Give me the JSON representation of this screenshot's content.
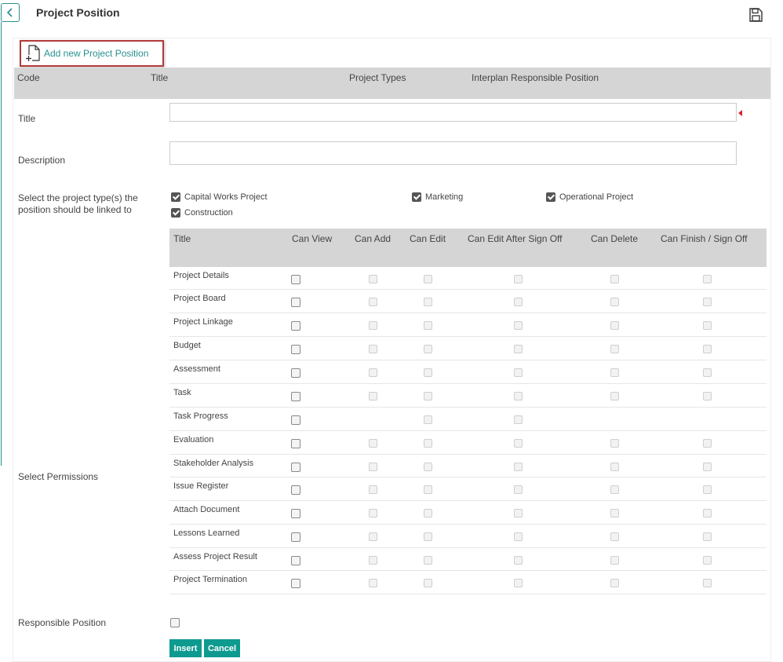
{
  "header": {
    "title": "Project Position",
    "back_icon": "chevron-left-icon",
    "save_icon": "floppy-disk-icon"
  },
  "toolbar": {
    "add_new_label": "Add new Project Position",
    "add_icon": "add-document-icon"
  },
  "grid": {
    "columns": [
      "Code",
      "Title",
      "Project Types",
      "Interplan Responsible Position"
    ]
  },
  "form": {
    "title_label": "Title",
    "title_value": "",
    "description_label": "Description",
    "description_value": "",
    "project_types_label": "Select the project type(s) the position should be linked to",
    "project_types": [
      {
        "label": "Capital Works Project",
        "checked": true
      },
      {
        "label": "Marketing",
        "checked": true
      },
      {
        "label": "Operational Project",
        "checked": true
      },
      {
        "label": "Construction",
        "checked": true
      }
    ],
    "permissions_label": "Select Permissions",
    "responsible_label": "Responsible Position",
    "responsible_checked": false
  },
  "permissions": {
    "columns": [
      "Title",
      "Can View",
      "Can Add",
      "Can Edit",
      "Can Edit After Sign Off",
      "Can Delete",
      "Can Finish / Sign Off"
    ],
    "rows": [
      {
        "title": "Project Details",
        "cells": [
          true,
          true,
          true,
          true,
          true,
          true
        ]
      },
      {
        "title": "Project Board",
        "cells": [
          true,
          true,
          true,
          true,
          true,
          true
        ]
      },
      {
        "title": "Project Linkage",
        "cells": [
          true,
          true,
          true,
          true,
          true,
          true
        ]
      },
      {
        "title": "Budget",
        "cells": [
          true,
          true,
          true,
          true,
          true,
          true
        ]
      },
      {
        "title": "Assessment",
        "cells": [
          true,
          true,
          true,
          true,
          true,
          true
        ]
      },
      {
        "title": "Task",
        "cells": [
          true,
          true,
          true,
          true,
          true,
          true
        ]
      },
      {
        "title": "Task Progress",
        "cells": [
          true,
          false,
          true,
          true,
          false,
          false
        ]
      },
      {
        "title": "Evaluation",
        "cells": [
          true,
          true,
          true,
          true,
          true,
          true
        ]
      },
      {
        "title": "Stakeholder Analysis",
        "cells": [
          true,
          true,
          true,
          true,
          true,
          true
        ]
      },
      {
        "title": "Issue Register",
        "cells": [
          true,
          true,
          true,
          true,
          true,
          true
        ]
      },
      {
        "title": "Attach Document",
        "cells": [
          true,
          true,
          true,
          true,
          true,
          true
        ]
      },
      {
        "title": "Lessons Learned",
        "cells": [
          true,
          true,
          true,
          true,
          true,
          true
        ]
      },
      {
        "title": "Assess Project Result",
        "cells": [
          true,
          true,
          true,
          true,
          true,
          true
        ]
      },
      {
        "title": "Project Termination",
        "cells": [
          true,
          true,
          true,
          true,
          true,
          true
        ]
      }
    ]
  },
  "buttons": {
    "insert": "Insert",
    "cancel": "Cancel"
  },
  "colors": {
    "accent": "#0e9a8f",
    "link": "#2a8f8f",
    "header_bg": "#d5d5d5",
    "highlight_border": "#b23a3a",
    "required": "#d9232d"
  }
}
